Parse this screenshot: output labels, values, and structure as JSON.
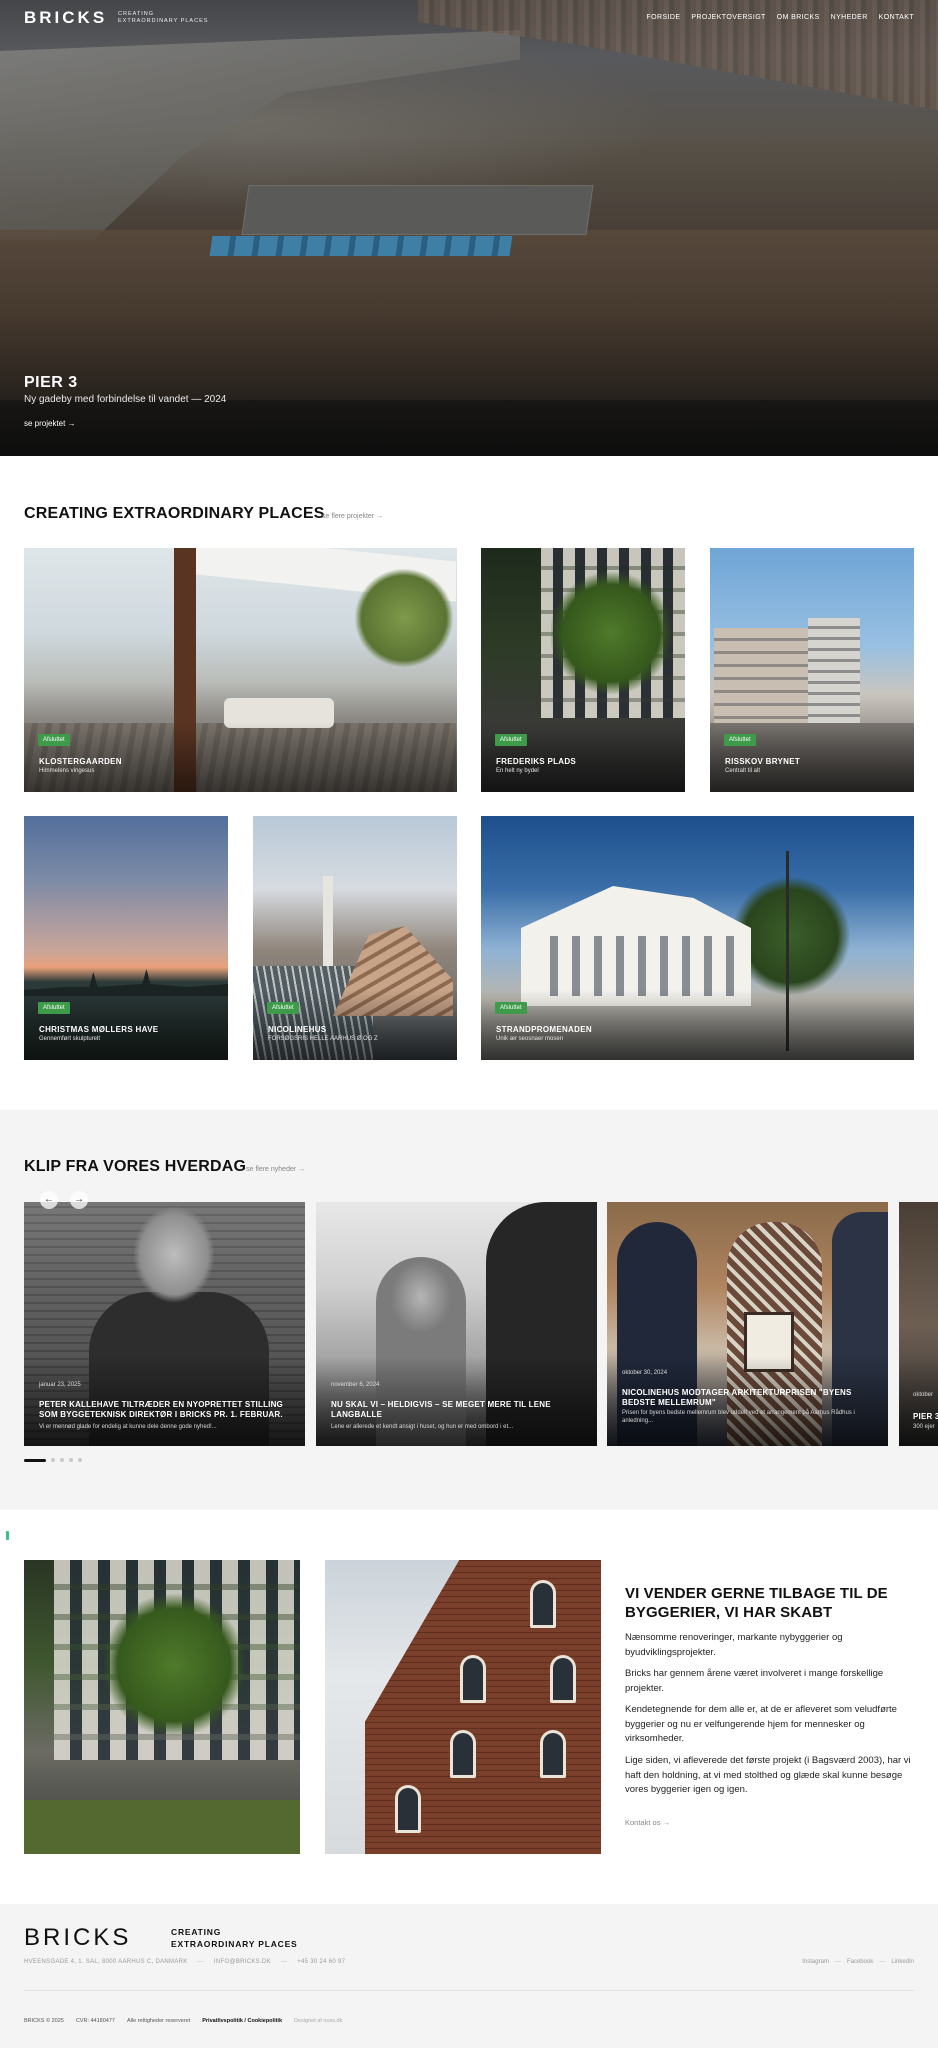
{
  "header": {
    "logo": "BRICKS",
    "tagline_line1": "CREATING",
    "tagline_line2": "EXTRAORDINARY PLACES",
    "nav": [
      "FORSIDE",
      "PROJEKTOVERSIGT",
      "OM BRICKS",
      "NYHEDER",
      "KONTAKT"
    ]
  },
  "hero": {
    "title": "PIER 3",
    "subtitle": "Ny gadeby med forbindelse til vandet — 2024",
    "link": "se projektet →"
  },
  "projects": {
    "title": "CREATING EXTRAORDINARY PLACES",
    "link": "se flere projekter →",
    "items": [
      {
        "badge": "Afsluttet",
        "name": "KLOSTERGAARDEN",
        "desc": "Himmelens vingesus"
      },
      {
        "badge": "Afsluttet",
        "name": "FREDERIKS PLADS",
        "desc": "En helt ny bydel"
      },
      {
        "badge": "Afsluttet",
        "name": "RISSKOV BRYNET",
        "desc": "Centralt til alt"
      },
      {
        "badge": "Afsluttet",
        "name": "CHRISTMAS MØLLERS HAVE",
        "desc": "Gennemført skulpturelt"
      },
      {
        "badge": "Afsluttet",
        "name": "NICOLINEHUS",
        "desc": "FORSØGSRIS HELLE AARHUS Ø OG Z"
      },
      {
        "badge": "Afsluttet",
        "name": "STRANDPROMENADEN",
        "desc": "Unik ær seosnaer mosen"
      }
    ],
    "badge_color": "#3d9b4a"
  },
  "news": {
    "title": "KLIP FRA VORES HVERDAG",
    "link": "se flere nyheder →",
    "prev_icon": "←",
    "next_icon": "→",
    "items": [
      {
        "date": "januar 23, 2025",
        "headline": "PETER KALLEHAVE TILTRÆDER EN NYOPRETTET STILLING SOM BYGGETEKNISK DIREKTØR I BRICKS PR. 1. FEBRUAR.",
        "excerpt": "Vi er mennød glade for endelig at kunne dele denne gode nyhed!..."
      },
      {
        "date": "november 6, 2024",
        "headline": "NU SKAL VI – HELDIGVIS – SE MEGET MERE TIL LENE LANGBALLE",
        "excerpt": "Lene er allerede et kendt ansigt i huset, og hun er med ombord i et..."
      },
      {
        "date": "oktober 30, 2024",
        "headline": "NICOLINEHUS MODTAGER ARKITEKTURPRISEN \"BYENS BEDSTE MELLEMRUM\"",
        "excerpt": "Prisen for byens bedste mellemrum blev uddelt ved et arrangement på Aarhus Rådhus i anledning..."
      },
      {
        "date": "oktober",
        "headline": "PIER 3",
        "excerpt": "300 ejer"
      }
    ]
  },
  "about": {
    "title": "VI VENDER GERNE TILBAGE TIL DE BYGGERIER, VI HAR SKABT",
    "paragraphs": [
      "Nænsomme renoveringer, markante nybyggerier og byudviklingsprojekter.",
      "Bricks har gennem årene været involveret i mange forskellige projekter.",
      "Kendetegnende for dem alle er, at de er afleveret som veludførte byggerier og nu er velfungerende hjem for mennesker og virksomheder.",
      "Lige siden, vi afleverede det første projekt (i Bagsværd 2003), har vi haft den holdning, at vi med stolthed og glæde skal kunne besøge vores byggerier igen og igen."
    ],
    "link": "Kontakt os →"
  },
  "footer": {
    "logo": "BRICKS",
    "tagline_line1": "CREATING",
    "tagline_line2": "EXTRAORDINARY PLACES",
    "address": "HVEENSGADE 4, 1. SAL, 8000 AARHUS C, DANMARK",
    "email": "INFO@BRICKS.DK",
    "phone": "+45 30 24 60 97",
    "social": [
      "Instagram",
      "Facebook",
      "LinkedIn"
    ],
    "copyright": "BRICKS © 2025",
    "cvr": "CVR: 44180477",
    "rights": "Alle rettigheder reserveret",
    "privacy": "Privatlivspolitik / Cookiepolitik",
    "credit": "Designet af nuxs.dk"
  }
}
